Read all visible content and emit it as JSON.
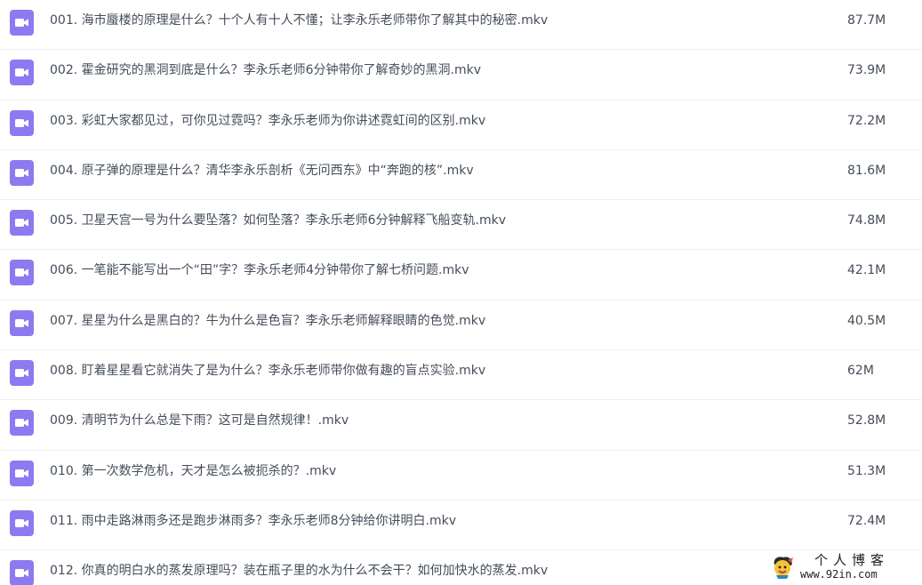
{
  "icon_color": "#8c7bf0",
  "files": [
    {
      "name": "001. 海市蜃楼的原理是什么？十个人有十人不懂；让李永乐老师带你了解其中的秘密.mkv",
      "size": "87.7M",
      "icon": "video-file-icon"
    },
    {
      "name": "002. 霍金研究的黑洞到底是什么？李永乐老师6分钟带你了解奇妙的黑洞.mkv",
      "size": "73.9M",
      "icon": "video-file-icon"
    },
    {
      "name": "003. 彩虹大家都见过，可你见过霓吗？李永乐老师为你讲述霓虹间的区别.mkv",
      "size": "72.2M",
      "icon": "video-file-icon"
    },
    {
      "name": "004. 原子弹的原理是什么？清华李永乐剖析《无问西东》中“奔跑的核”.mkv",
      "size": "81.6M",
      "icon": "video-file-icon"
    },
    {
      "name": "005. 卫星天宫一号为什么要坠落？如何坠落？李永乐老师6分钟解释飞船变轨.mkv",
      "size": "74.8M",
      "icon": "video-file-icon"
    },
    {
      "name": "006. 一笔能不能写出一个“田”字？李永乐老师4分钟带你了解七桥问题.mkv",
      "size": "42.1M",
      "icon": "video-file-icon"
    },
    {
      "name": "007. 星星为什么是黑白的？牛为什么是色盲？李永乐老师解释眼睛的色觉.mkv",
      "size": "40.5M",
      "icon": "video-file-icon"
    },
    {
      "name": "008. 盯着星星看它就消失了是为什么？李永乐老师带你做有趣的盲点实验.mkv",
      "size": "62M",
      "icon": "video-file-icon"
    },
    {
      "name": "009. 清明节为什么总是下雨？这可是自然规律！.mkv",
      "size": "52.8M",
      "icon": "video-file-icon"
    },
    {
      "name": "010. 第一次数学危机，天才是怎么被扼杀的？.mkv",
      "size": "51.3M",
      "icon": "video-file-icon"
    },
    {
      "name": "011. 雨中走路淋雨多还是跑步淋雨多？李永乐老师8分钟给你讲明白.mkv",
      "size": "72.4M",
      "icon": "video-file-icon"
    },
    {
      "name": "012. 你真的明白水的蒸发原理吗？装在瓶子里的水为什么不会干？如何加快水的蒸发.mkv",
      "size": "",
      "icon": "video-file-icon"
    }
  ],
  "watermark": {
    "title": "个人博客",
    "url": "www.92in.com",
    "icon": "mascot-logo-icon"
  }
}
